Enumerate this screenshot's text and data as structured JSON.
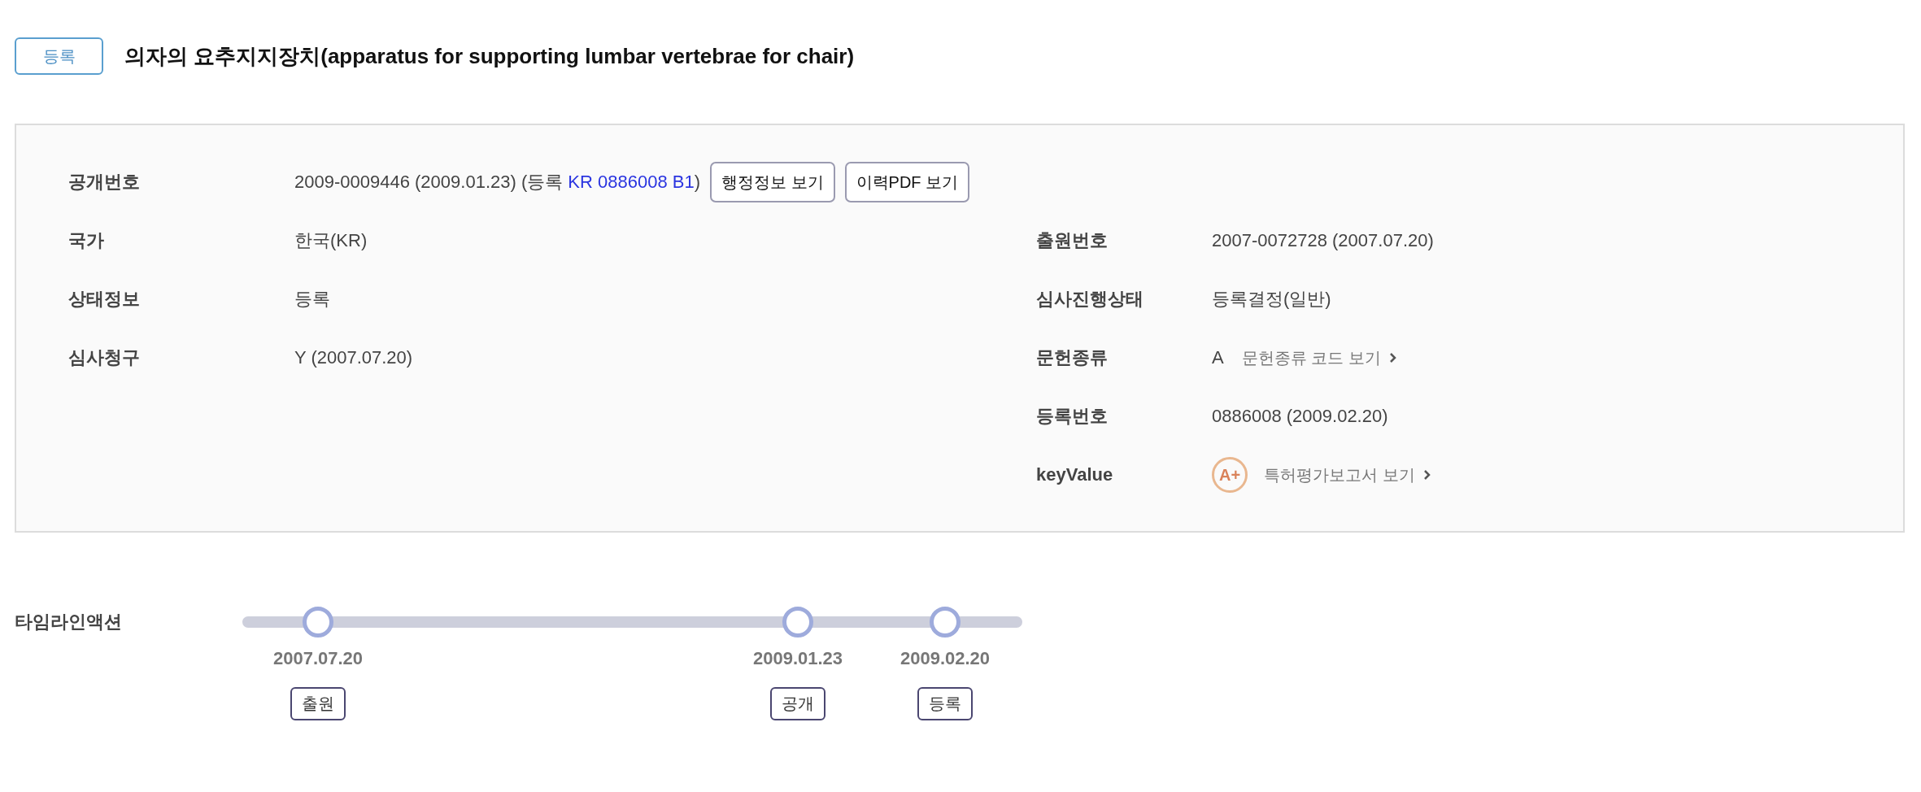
{
  "header": {
    "status_badge": "등록",
    "title": "의자의 요추지지장치(apparatus for supporting lumbar vertebrae for chair)"
  },
  "summary": {
    "publication": {
      "label": "공개번호",
      "value_prefix": "2009-0009446 (2009.01.23) (등록 ",
      "link": "KR 0886008 B1",
      "value_suffix": ")",
      "buttons": [
        "행정정보 보기",
        "이력PDF 보기"
      ]
    },
    "left_fields": [
      {
        "label": "국가",
        "value": "한국(KR)"
      },
      {
        "label": "상태정보",
        "value": "등록"
      },
      {
        "label": "심사청구",
        "value": "Y (2007.07.20)"
      }
    ],
    "right_fields": [
      {
        "kind": "text",
        "label": "출원번호",
        "value": "2007-0072728 (2007.07.20)"
      },
      {
        "kind": "text",
        "label": "심사진행상태",
        "value": "등록결정(일반)"
      },
      {
        "kind": "code",
        "label": "문헌종류",
        "value": "A",
        "link": "문헌종류 코드 보기"
      },
      {
        "kind": "text",
        "label": "등록번호",
        "value": "0886008 (2009.02.20)"
      },
      {
        "kind": "grade",
        "label": "keyValue",
        "grade": "A+",
        "link": "특허평가보고서 보기"
      }
    ]
  },
  "timeline": {
    "label": "타임라인액션",
    "events": [
      {
        "date": "2007.07.20",
        "tag": "출원"
      },
      {
        "date": "2009.01.23",
        "tag": "공개"
      },
      {
        "date": "2009.02.20",
        "tag": "등록"
      }
    ]
  }
}
